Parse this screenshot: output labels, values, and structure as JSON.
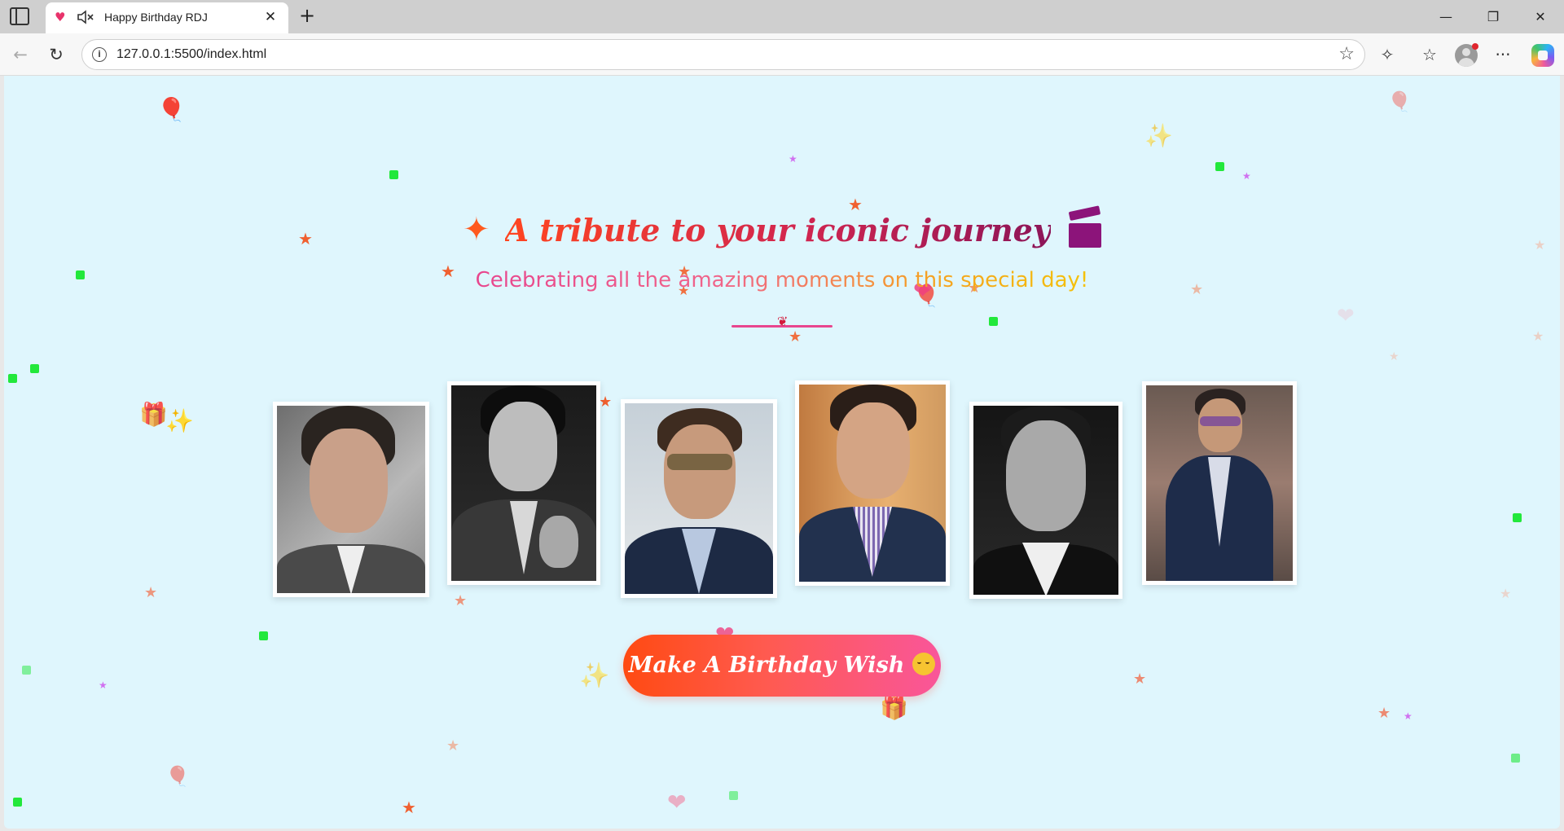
{
  "browser": {
    "tab_title": "Happy Birthday RDJ",
    "url": "127.0.0.1:5500/index.html",
    "close_glyph": "✕",
    "new_tab_glyph": "+",
    "minimize_glyph": "—",
    "restore_glyph": "❐",
    "close_window_glyph": "✕",
    "back_glyph": "←",
    "reload_glyph": "↻",
    "info_glyph": "i",
    "favorite_glyph": "☆",
    "extensions_glyph": "✧",
    "favorites_bar_glyph": "☆",
    "more_glyph": "···",
    "favicon_glyph": "♥"
  },
  "page": {
    "heading": "A tribute to your iconic journey",
    "subtitle": "Celebrating all the amazing moments on this special day!",
    "wish_button_label": "Make A Birthday Wish",
    "heading_sparkle": "✦",
    "divider_rose": "❦"
  },
  "photos": [
    {
      "name": "portrait-1",
      "tone": "color-grey"
    },
    {
      "name": "portrait-2",
      "tone": "black-white"
    },
    {
      "name": "portrait-3",
      "tone": "color-sunglasses"
    },
    {
      "name": "portrait-4",
      "tone": "color-warm"
    },
    {
      "name": "portrait-5",
      "tone": "black-white"
    },
    {
      "name": "portrait-6",
      "tone": "color-red-carpet"
    }
  ],
  "colors": {
    "page_background": "#dff6fd",
    "heading_start": "#ff4520",
    "heading_end": "#8c1558",
    "subtitle_start": "#e8468e",
    "subtitle_end": "#f4c20a",
    "button_start": "#ff4a12",
    "button_end": "#f9569a",
    "confetti": "#22e83b",
    "star": "#f07040"
  },
  "decorations": {
    "star_glyph": "★",
    "balloon_glyph": "🎈",
    "gift_glyph": "🎁",
    "sparkle_glyph": "✨",
    "heart_glyph": "❤"
  }
}
